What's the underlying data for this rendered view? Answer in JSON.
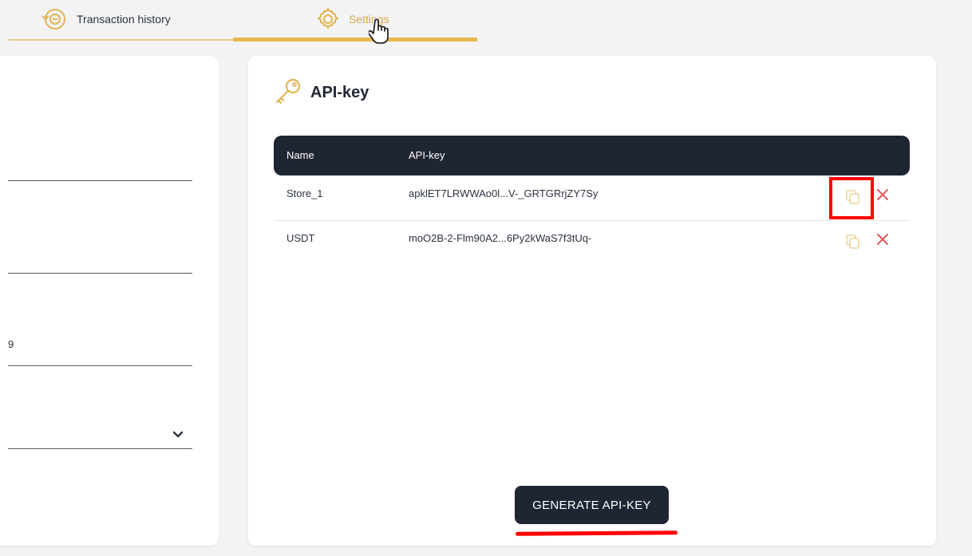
{
  "tabs": [
    {
      "label": "Transaction history",
      "icon": "transaction-history-icon",
      "active": false
    },
    {
      "label": "Settings",
      "icon": "gear-icon",
      "active": true
    }
  ],
  "left_panel": {
    "visible_value": "9"
  },
  "api_card": {
    "title": "API-key",
    "title_icon": "key-icon",
    "columns": [
      "Name",
      "API-key"
    ],
    "rows": [
      {
        "name": "Store_1",
        "key": "apklET7LRWWAo0l...V-_GRTGRrjZY7Sy"
      },
      {
        "name": "USDT",
        "key": "moO2B-2-Flm90A2...6Py2kWaS7f3tUq-"
      }
    ],
    "generate_label": "GENERATE API-KEY"
  },
  "colors": {
    "accent": "#e8b84c",
    "dark": "#1f2633",
    "delete": "#e05a5a",
    "annotation": "#ff0000"
  }
}
